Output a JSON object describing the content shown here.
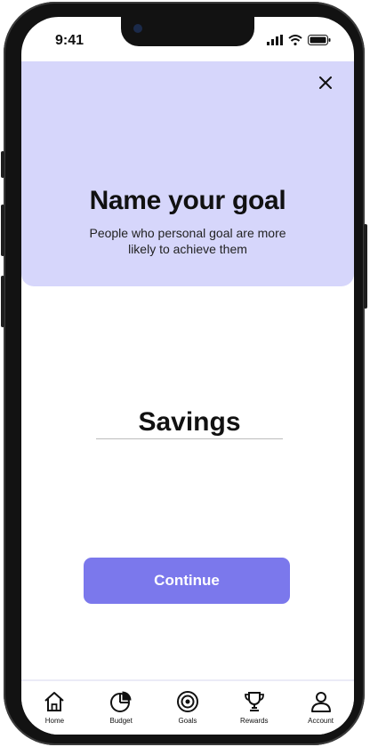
{
  "status_bar": {
    "time": "9:41"
  },
  "header": {
    "title": "Name your goal",
    "subtitle": "People who personal goal are more likely to achieve them"
  },
  "goal_input": {
    "value": "Savings"
  },
  "continue_button": {
    "label": "Continue"
  },
  "tabs": [
    {
      "label": "Home",
      "icon": "home-icon"
    },
    {
      "label": "Budget",
      "icon": "pie-chart-icon"
    },
    {
      "label": "Goals",
      "icon": "target-icon"
    },
    {
      "label": "Rewards",
      "icon": "trophy-icon"
    },
    {
      "label": "Account",
      "icon": "user-icon"
    }
  ],
  "colors": {
    "header_bg": "#d6d6fb",
    "accent": "#7b78ec"
  }
}
